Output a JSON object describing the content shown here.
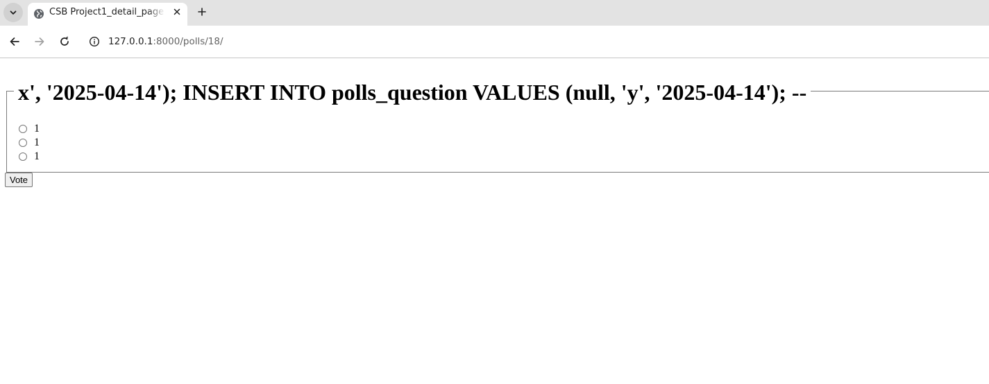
{
  "browser": {
    "tab": {
      "title": "CSB Project1_detail_page",
      "favicon": "globe-icon"
    },
    "address_bar": {
      "host": "127.0.0.1",
      "path": ":8000/polls/18/"
    }
  },
  "poll": {
    "question": "x', '2025-04-14'); INSERT INTO polls_question VALUES (null, 'y', '2025-04-14'); --",
    "choices": [
      {
        "label": "1"
      },
      {
        "label": "1"
      },
      {
        "label": "1"
      }
    ],
    "vote_label": "Vote"
  }
}
